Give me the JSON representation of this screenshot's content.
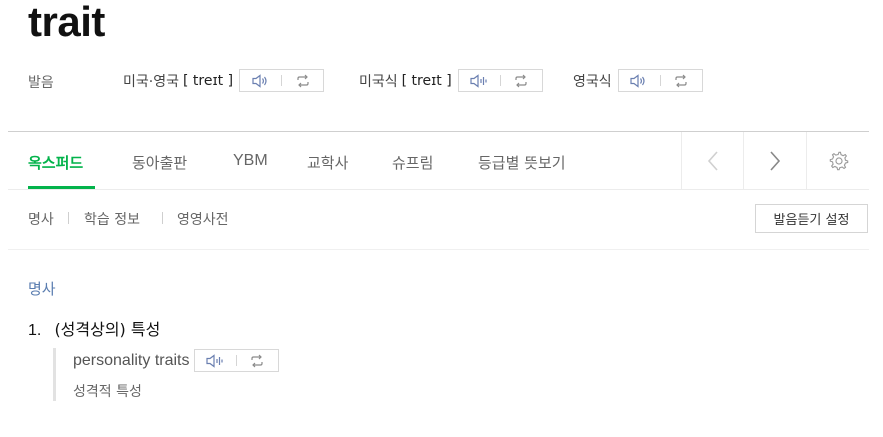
{
  "entry": {
    "word": "trait"
  },
  "pronunciation": {
    "label": "발음",
    "groups": [
      {
        "prefix": "미국·영국",
        "ipa": "[ treɪt ]",
        "play_icon": "speaker-icon",
        "repeat_icon": "repeat-icon"
      },
      {
        "prefix": "미국식",
        "ipa": "[ treɪt ]",
        "play_icon": "speaker-wave-icon",
        "repeat_icon": "repeat-icon"
      },
      {
        "prefix": "영국식",
        "ipa": "",
        "play_icon": "speaker-icon",
        "repeat_icon": "repeat-icon"
      }
    ]
  },
  "tabs": {
    "items": [
      "옥스퍼드",
      "동아출판",
      "YBM",
      "교학사",
      "슈프림",
      "등급별 뜻보기"
    ],
    "active": "옥스퍼드",
    "accent": "#03b34b"
  },
  "subnav": {
    "items": [
      "명사",
      "학습 정보",
      "영영사전"
    ],
    "setting_button": "발음듣기 설정"
  },
  "content": {
    "pos": "명사",
    "definitions": [
      {
        "number": "1.",
        "text": "(성격상의) 특성",
        "example_en": "personality traits",
        "example_ko": "성격적 특성"
      }
    ]
  }
}
